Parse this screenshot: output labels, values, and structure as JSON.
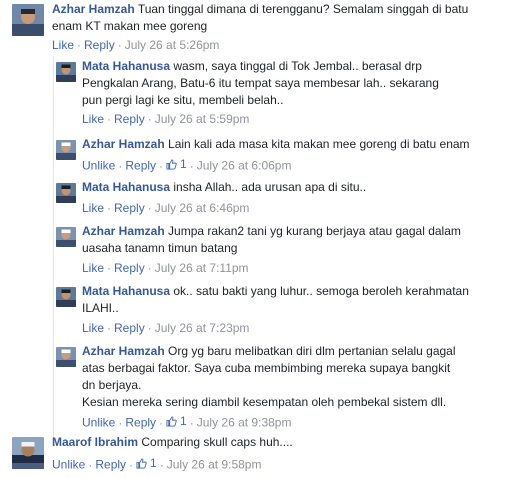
{
  "comments": [
    {
      "author": "Azhar Hamzah",
      "text": "Tuan tinggal dimana di terengganu? Semalam singgah di batu enam KT makan mee goreng",
      "actions": {
        "like": "Like",
        "reply": "Reply",
        "time": "July 26 at 5:26pm"
      }
    },
    {
      "author": "Mata Hahanusa",
      "text": "wasm, saya tinggal di Tok Jembal.. berasal drp Pengkalan Arang, Batu-6 itu tempat saya membesar lah.. sekarang pun pergi lagi ke situ, membeli belah..",
      "actions": {
        "like": "Like",
        "reply": "Reply",
        "time": "July 26 at 5:59pm"
      }
    },
    {
      "author": "Azhar Hamzah",
      "text": "Lain kali ada masa kita makan mee goreng di batu enam",
      "actions": {
        "like": "Unlike",
        "reply": "Reply",
        "likes": "1",
        "time": "July 26 at 6:06pm"
      }
    },
    {
      "author": "Mata Hahanusa",
      "text": "insha Allah.. ada urusan apa di situ..",
      "actions": {
        "like": "Like",
        "reply": "Reply",
        "time": "July 26 at 6:46pm"
      }
    },
    {
      "author": "Azhar Hamzah",
      "text": "Jumpa rakan2 tani yg kurang berjaya atau gagal dalam uasaha tanamn timun batang",
      "actions": {
        "like": "Like",
        "reply": "Reply",
        "time": "July 26 at 7:11pm"
      }
    },
    {
      "author": "Mata Hahanusa",
      "text": "ok.. satu bakti yang luhur.. semoga beroleh kerahmatan ILAHI..",
      "actions": {
        "like": "Like",
        "reply": "Reply",
        "time": "July 26 at 7:23pm"
      }
    },
    {
      "author": "Azhar Hamzah",
      "text": "Org yg baru melibatkan diri dlm pertanian selalu gagal atas berbagai faktor. Saya cuba membimbing mereka supaya bangkit dn berjaya.",
      "text2": "Kesian mereka sering diambil kesempatan oleh pembekal sistem dll.",
      "actions": {
        "like": "Unlike",
        "reply": "Reply",
        "likes": "1",
        "time": "July 26 at 9:38pm"
      }
    },
    {
      "author": "Maarof Ibrahim",
      "text": "Comparing skull caps huh....",
      "actions": {
        "like": "Unlike",
        "reply": "Reply",
        "likes": "1",
        "time": "July 26 at 9:58pm"
      }
    }
  ],
  "colors": {
    "name": "#365899",
    "link": "#4267b2",
    "meta": "#90949c"
  }
}
